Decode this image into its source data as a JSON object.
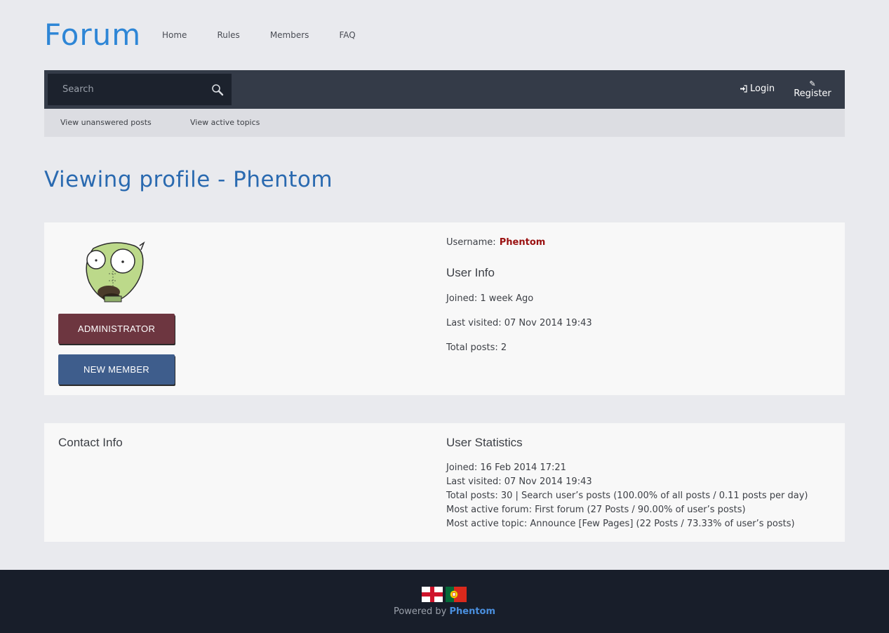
{
  "brand": "Forum",
  "top_nav": [
    "Home",
    "Rules",
    "Members",
    "FAQ"
  ],
  "search": {
    "placeholder": "Search"
  },
  "auth": {
    "login": "Login",
    "register": "Register"
  },
  "sub_nav": [
    "View unanswered posts",
    "View active topics"
  ],
  "page_title": "Viewing profile - Phentom",
  "profile": {
    "ranks": [
      "ADMINISTRATOR",
      "NEW MEMBER"
    ],
    "username_label": "Username:",
    "username": "Phentom",
    "user_info_heading": "User Info",
    "joined": "Joined: 1 week Ago",
    "last_visited": "Last visited: 07 Nov 2014 19:43",
    "total_posts": "Total posts: 2"
  },
  "contact": {
    "heading": "Contact Info"
  },
  "stats": {
    "heading": "User Statistics",
    "lines": [
      "Joined: 16 Feb 2014 17:21",
      "Last visited: 07 Nov 2014 19:43",
      "Total posts: 30 | Search user’s posts (100.00% of all posts / 0.11 posts per day)",
      "Most active forum: First forum (27 Posts / 90.00% of user’s posts)",
      "Most active topic: Announce [Few Pages] (22 Posts / 73.33% of user’s posts)"
    ]
  },
  "footer": {
    "flags": [
      "england-flag",
      "portugal-flag"
    ],
    "powered_by": "Powered by",
    "author": "Phentom"
  },
  "colors": {
    "brand": "#2e86d6",
    "navbar": "#343b48",
    "username": "#9a1010",
    "admin_rank": "#6d3640",
    "new_member_rank": "#3e5d8c",
    "footer": "#181e2a"
  }
}
